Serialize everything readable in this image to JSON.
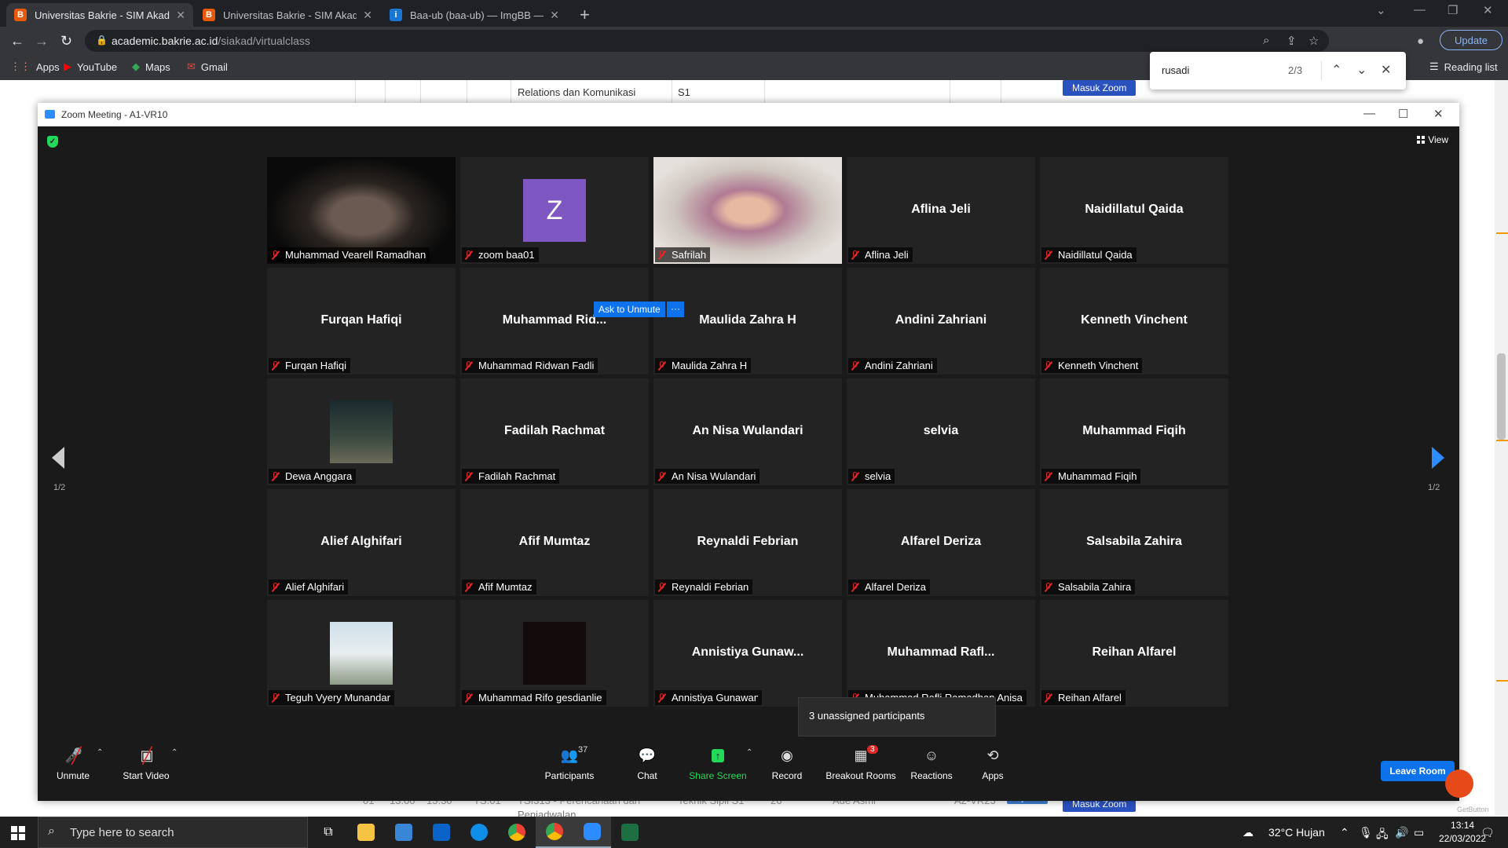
{
  "browser": {
    "tabs": [
      {
        "title": "Universitas Bakrie - SIM Akadem",
        "active": true
      },
      {
        "title": "Universitas Bakrie - SIM Akadem",
        "active": false
      },
      {
        "title": "Baa-ub (baa-ub) — ImgBB — Lar",
        "active": false
      }
    ],
    "url_host": "academic.bakrie.ac.id",
    "url_path": "/siakad/virtualclass",
    "update_label": "Update",
    "bookmarks": [
      "Apps",
      "YouTube",
      "Maps",
      "Gmail"
    ],
    "reading_list": "Reading list",
    "find": {
      "query": "rusadi",
      "count": "2/3"
    }
  },
  "page": {
    "row_top": {
      "course": "Relations dan Komunikasi",
      "level": "S1",
      "button": "Masuk Zoom"
    },
    "row_bottom": {
      "no": "01",
      "start": "13:00",
      "end": "15:30",
      "code": "TS.01",
      "course": "TSI313 - Perencanaan dan",
      "course2": "Penjadwalan",
      "prodi": "Teknik Sipil S1",
      "count": "26",
      "lecturer": "Ade Asmi",
      "room": "A2-VR23",
      "status": "Terjadwal",
      "button": "Masuk Zoom"
    },
    "brand_small": "GetButton"
  },
  "zoom": {
    "window_title": "Zoom Meeting - A1-VR10",
    "view_label": "View",
    "page_indicator": "1/2",
    "ask_unmute": "Ask to Unmute",
    "more": "···",
    "tooltip": "3 unassigned participants",
    "participants": [
      {
        "label": "Muhammad Vearell Ramadhan",
        "center": "",
        "kind": "video-dark"
      },
      {
        "label": "zoom baa01",
        "center": "",
        "kind": "avatar",
        "initial": "Z"
      },
      {
        "label": "Safrilah",
        "center": "",
        "kind": "video-light",
        "speaking": true
      },
      {
        "label": "Aflina Jeli",
        "center": "Aflina Jeli"
      },
      {
        "label": "Naidillatul Qaida",
        "center": "Naidillatul Qaida"
      },
      {
        "label": "Furqan Hafiqi",
        "center": "Furqan Hafiqi"
      },
      {
        "label": "Muhammad Ridwan Fadli",
        "center": "Muhammad  Rid..."
      },
      {
        "label": "Maulida Zahra H",
        "center": "Maulida Zahra H"
      },
      {
        "label": "Andini Zahriani",
        "center": "Andini Zahriani"
      },
      {
        "label": "Kenneth Vinchent",
        "center": "Kenneth Vinchent"
      },
      {
        "label": "Dewa Anggara",
        "center": "",
        "kind": "thumb-night"
      },
      {
        "label": "Fadilah Rachmat",
        "center": "Fadilah Rachmat"
      },
      {
        "label": "An Nisa Wulandari",
        "center": "An Nisa Wulandari"
      },
      {
        "label": "selvia",
        "center": "selvia"
      },
      {
        "label": "Muhammad Fiqih",
        "center": "Muhammad Fiqih"
      },
      {
        "label": "Alief Alghifari",
        "center": "Alief Alghifari"
      },
      {
        "label": "Afif Mumtaz",
        "center": "Afif Mumtaz"
      },
      {
        "label": "Reynaldi Febrian",
        "center": "Reynaldi Febrian"
      },
      {
        "label": "Alfarel Deriza",
        "center": "Alfarel Deriza"
      },
      {
        "label": "Salsabila Zahira",
        "center": "Salsabila Zahira"
      },
      {
        "label": "Teguh Vyery Munandar",
        "center": "",
        "kind": "thumb-person"
      },
      {
        "label": "Muhammad Rifo gesdianlie",
        "center": "",
        "kind": "thumb-dark"
      },
      {
        "label": "Annistiya Gunawan",
        "center": "Annistiya  Gunaw..."
      },
      {
        "label": "Muhammad Rafli Ramadhan Anisa",
        "center": "Muhammad  Rafl..."
      },
      {
        "label": "Reihan Alfarel",
        "center": "Reihan Alfarel"
      }
    ],
    "controls": {
      "unmute": "Unmute",
      "start_video": "Start Video",
      "participants": "Participants",
      "participants_count": "37",
      "chat": "Chat",
      "share_screen": "Share Screen",
      "record": "Record",
      "breakout": "Breakout Rooms",
      "breakout_badge": "3",
      "reactions": "Reactions",
      "apps": "Apps",
      "leave": "Leave Room"
    }
  },
  "taskbar": {
    "search_placeholder": "Type here to search",
    "weather": "32°C  Hujan",
    "time": "13:14",
    "date": "22/03/2022"
  },
  "colors": {
    "zoom_blue": "#0e72ed",
    "mute_red": "#e02828",
    "speaking_yellow": "#f5f589",
    "share_green": "#23d959",
    "avatar_purple": "#7e57c2"
  }
}
